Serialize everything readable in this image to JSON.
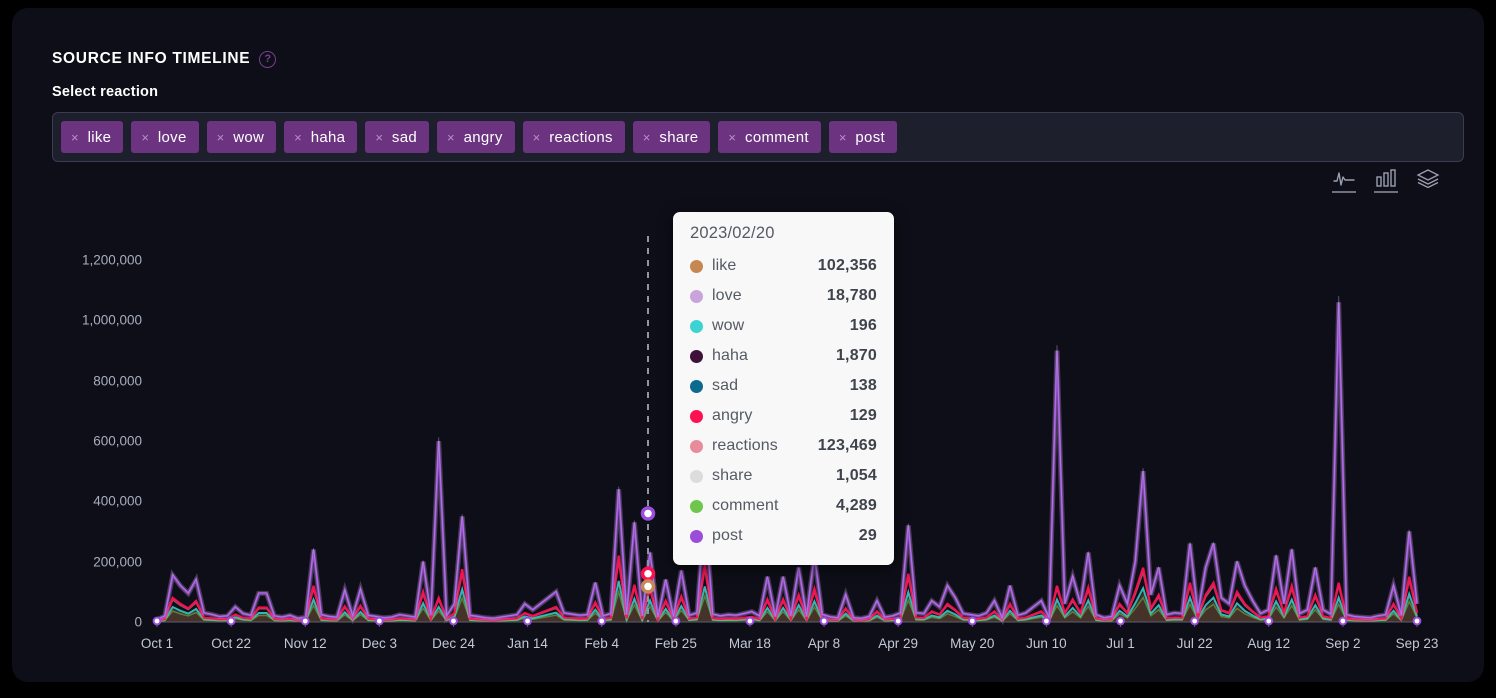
{
  "panel": {
    "title": "SOURCE INFO TIMELINE",
    "help_icon": "help-circle-icon",
    "sub_label": "Select reaction",
    "bg_color": "#0d0e17"
  },
  "select": {
    "placeholder": "Select reaction",
    "chips": [
      {
        "label": "like",
        "remove": "×"
      },
      {
        "label": "love",
        "remove": "×"
      },
      {
        "label": "wow",
        "remove": "×"
      },
      {
        "label": "haha",
        "remove": "×"
      },
      {
        "label": "sad",
        "remove": "×"
      },
      {
        "label": "angry",
        "remove": "×"
      },
      {
        "label": "reactions",
        "remove": "×"
      },
      {
        "label": "share",
        "remove": "×"
      },
      {
        "label": "comment",
        "remove": "×"
      },
      {
        "label": "post",
        "remove": "×"
      }
    ]
  },
  "chart_toggles": [
    {
      "name": "line-chart-icon",
      "selected": true
    },
    {
      "name": "bar-chart-icon",
      "selected": true
    },
    {
      "name": "stacked-layers-icon",
      "selected": false
    }
  ],
  "tooltip": {
    "date": "2023/02/20",
    "rows": [
      {
        "name": "like",
        "value": "102,356",
        "color": "#c68753"
      },
      {
        "name": "love",
        "value": "18,780",
        "color": "#c9a3da"
      },
      {
        "name": "wow",
        "value": "196",
        "color": "#3cd3d3"
      },
      {
        "name": "haha",
        "value": "1,870",
        "color": "#3d1138"
      },
      {
        "name": "sad",
        "value": "138",
        "color": "#0d6a8f"
      },
      {
        "name": "angry",
        "value": "129",
        "color": "#fb1152"
      },
      {
        "name": "reactions",
        "value": "123,469",
        "color": "#e88b9a"
      },
      {
        "name": "share",
        "value": "1,054",
        "color": "#dcdcdc"
      },
      {
        "name": "comment",
        "value": "4,289",
        "color": "#6ec64c"
      },
      {
        "name": "post",
        "value": "29",
        "color": "#9b4cdb"
      }
    ]
  },
  "chart_data": {
    "type": "line",
    "title": "SOURCE INFO TIMELINE",
    "xlabel": "",
    "ylabel": "",
    "grid": false,
    "legend_position": "tooltip",
    "ylim": [
      0,
      1280000
    ],
    "yticks": [
      0,
      200000,
      400000,
      600000,
      800000,
      1000000,
      1200000
    ],
    "ytick_labels": [
      "0",
      "200,000",
      "400,000",
      "600,000",
      "800,000",
      "1,000,000",
      "1,200,000"
    ],
    "xtick_labels": [
      "Oct 1",
      "Oct 22",
      "Nov 12",
      "Dec 3",
      "Dec 24",
      "Jan 14",
      "Feb 4",
      "Feb 25",
      "Mar 18",
      "Apr 8",
      "Apr 29",
      "May 20",
      "Jun 10",
      "Jul 1",
      "Jul 22",
      "Aug 12",
      "Sep 2",
      "Sep 23"
    ],
    "x_start": "Oct 1",
    "x_end": "Sep 23",
    "hover_x": "2023/02/20",
    "series": [
      {
        "name": "like",
        "color": "#c68753",
        "hover_value": 102356
      },
      {
        "name": "love",
        "color": "#c9a3da",
        "hover_value": 18780
      },
      {
        "name": "wow",
        "color": "#3cd3d3",
        "hover_value": 196
      },
      {
        "name": "haha",
        "color": "#3d1138",
        "hover_value": 1870
      },
      {
        "name": "sad",
        "color": "#0d6a8f",
        "hover_value": 138
      },
      {
        "name": "angry",
        "color": "#fb1152",
        "hover_value": 129
      },
      {
        "name": "reactions",
        "color": "#e88b9a",
        "hover_value": 123469
      },
      {
        "name": "share",
        "color": "#dcdcdc",
        "hover_value": 1054
      },
      {
        "name": "comment",
        "color": "#6ec64c",
        "hover_value": 4289
      },
      {
        "name": "post",
        "color": "#9b4cdb",
        "hover_value": 29
      }
    ],
    "post_values": [
      8000,
      20000,
      155000,
      120000,
      95000,
      140000,
      30000,
      25000,
      18000,
      20000,
      50000,
      28000,
      22000,
      95000,
      95000,
      20000,
      16000,
      22000,
      12000,
      16000,
      240000,
      24000,
      18000,
      16000,
      105000,
      20000,
      108000,
      22000,
      18000,
      14000,
      16000,
      24000,
      20000,
      16000,
      200000,
      22000,
      600000,
      20000,
      60000,
      350000,
      22000,
      18000,
      14000,
      12000,
      16000,
      20000,
      24000,
      60000,
      40000,
      60000,
      80000,
      100000,
      30000,
      26000,
      22000,
      24000,
      130000,
      20000,
      28000,
      440000,
      24000,
      330000,
      20000,
      230000,
      16000,
      140000,
      18000,
      170000,
      22000,
      30000,
      380000,
      26000,
      20000,
      24000,
      22000,
      28000,
      34000,
      20000,
      150000,
      18000,
      150000,
      20000,
      180000,
      18000,
      220000,
      25000,
      17000,
      14000,
      90000,
      14000,
      12000,
      18000,
      70000,
      16000,
      20000,
      30000,
      320000,
      30000,
      28000,
      70000,
      50000,
      120000,
      80000,
      28000,
      24000,
      20000,
      30000,
      70000,
      14000,
      120000,
      22000,
      30000,
      50000,
      70000,
      14000,
      900000,
      60000,
      150000,
      60000,
      230000,
      24000,
      14000,
      18000,
      120000,
      60000,
      200000,
      500000,
      90000,
      180000,
      24000,
      30000,
      28000,
      260000,
      30000,
      180000,
      260000,
      80000,
      60000,
      200000,
      120000,
      70000,
      28000,
      40000,
      220000,
      60000,
      240000,
      28000,
      40000,
      180000,
      40000,
      26000,
      1060000,
      24000,
      18000,
      16000,
      14000,
      20000,
      24000,
      120000,
      22000,
      300000,
      60000
    ],
    "reactions_values": [
      4000,
      10000,
      80000,
      60000,
      45000,
      70000,
      14000,
      12000,
      9000,
      10000,
      25000,
      14000,
      11000,
      48000,
      48000,
      10000,
      8000,
      11000,
      6000,
      8000,
      120000,
      12000,
      9000,
      8000,
      52000,
      10000,
      54000,
      11000,
      9000,
      7000,
      8000,
      12000,
      10000,
      8000,
      100000,
      11000,
      80000,
      10000,
      30000,
      175000,
      11000,
      9000,
      7000,
      6000,
      8000,
      10000,
      12000,
      30000,
      20000,
      30000,
      40000,
      50000,
      15000,
      13000,
      11000,
      12000,
      65000,
      10000,
      14000,
      220000,
      12000,
      123469,
      10000,
      115000,
      8000,
      70000,
      9000,
      85000,
      11000,
      15000,
      190000,
      13000,
      10000,
      12000,
      11000,
      14000,
      17000,
      10000,
      75000,
      9000,
      75000,
      10000,
      90000,
      9000,
      110000,
      12000,
      8000,
      7000,
      45000,
      7000,
      6000,
      9000,
      35000,
      8000,
      10000,
      15000,
      160000,
      15000,
      14000,
      35000,
      25000,
      60000,
      40000,
      14000,
      12000,
      10000,
      15000,
      35000,
      7000,
      60000,
      11000,
      15000,
      25000,
      35000,
      7000,
      120000,
      30000,
      75000,
      30000,
      115000,
      12000,
      7000,
      9000,
      60000,
      30000,
      100000,
      180000,
      45000,
      90000,
      12000,
      15000,
      14000,
      130000,
      15000,
      90000,
      130000,
      40000,
      30000,
      100000,
      60000,
      35000,
      14000,
      20000,
      110000,
      30000,
      120000,
      14000,
      20000,
      90000,
      20000,
      13000,
      130000,
      12000,
      9000,
      8000,
      7000,
      10000,
      12000,
      60000,
      11000,
      150000,
      30000
    ]
  }
}
